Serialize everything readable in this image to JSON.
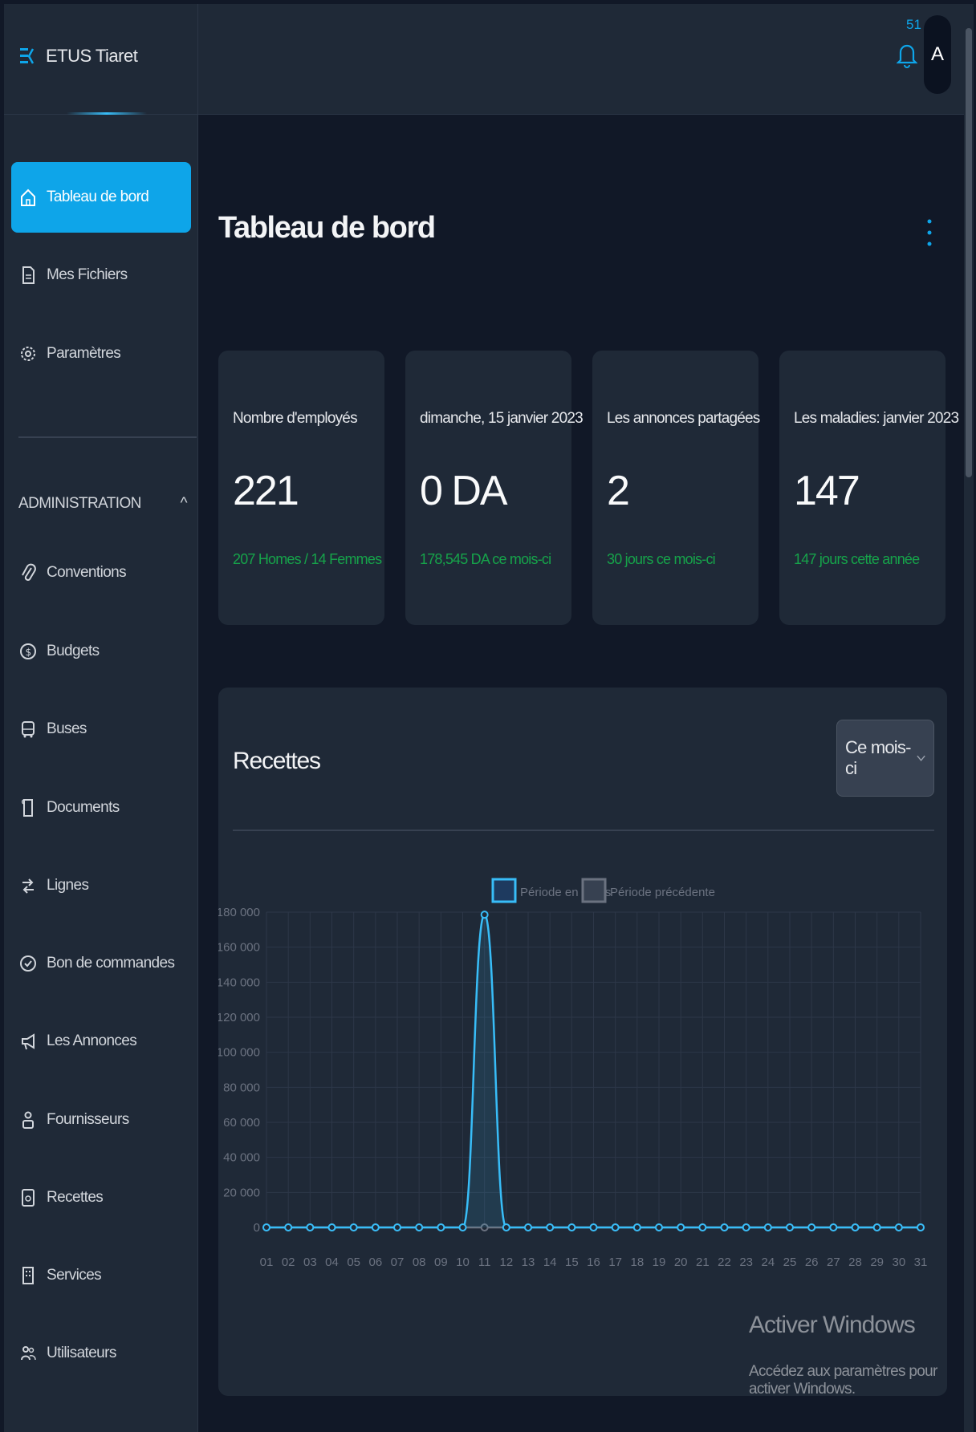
{
  "app": {
    "title": "ETUS Tiaret"
  },
  "header": {
    "notifications_count": "51",
    "avatar_initial": "A"
  },
  "sidebar": {
    "items": [
      {
        "label": "Tableau de bord",
        "icon": "home-icon",
        "active": true
      },
      {
        "label": "Mes Fichiers",
        "icon": "file-icon"
      },
      {
        "label": "Paramètres",
        "icon": "gear-icon"
      }
    ],
    "section": {
      "title": "ADMINISTRATION",
      "toggle": "^"
    },
    "admin_items": [
      {
        "label": "Conventions",
        "icon": "paperclip-icon"
      },
      {
        "label": "Budgets",
        "icon": "dollar-icon"
      },
      {
        "label": "Buses",
        "icon": "bus-icon"
      },
      {
        "label": "Documents",
        "icon": "document-icon"
      },
      {
        "label": "Lignes",
        "icon": "arrows-icon"
      },
      {
        "label": "Bon de commandes",
        "icon": "check-circle-icon"
      },
      {
        "label": "Les Annonces",
        "icon": "megaphone-icon"
      },
      {
        "label": "Fournisseurs",
        "icon": "users-icon"
      },
      {
        "label": "Recettes",
        "icon": "receipt-icon"
      },
      {
        "label": "Services",
        "icon": "building-icon"
      },
      {
        "label": "Utilisateurs",
        "icon": "user-group-icon"
      }
    ]
  },
  "main": {
    "title": "Tableau de bord",
    "cards": [
      {
        "label": "Nombre d'employés",
        "value": "221",
        "sub": "207 Homes / 14 Femmes"
      },
      {
        "label": "dimanche, 15 janvier 2023",
        "value": "0 DA",
        "sub": "178,545 DA ce mois-ci"
      },
      {
        "label": "Les annonces partagées",
        "value": "2",
        "sub": "30 jours ce mois-ci"
      },
      {
        "label": "Les maladies: janvier 2023",
        "value": "147",
        "sub": "147 jours cette année"
      }
    ],
    "panel": {
      "title": "Recettes",
      "select_value": "Ce mois-ci"
    }
  },
  "chart_data": {
    "type": "area",
    "title": "",
    "xlabel": "",
    "ylabel": "",
    "ylim": [
      0,
      180000
    ],
    "yticks": [
      "0",
      "20 000",
      "40 000",
      "60 000",
      "80 000",
      "100 000",
      "120 000",
      "140 000",
      "160 000",
      "180 000"
    ],
    "x": [
      "01",
      "02",
      "03",
      "04",
      "05",
      "06",
      "07",
      "08",
      "09",
      "10",
      "11",
      "12",
      "13",
      "14",
      "15",
      "16",
      "17",
      "18",
      "19",
      "20",
      "21",
      "22",
      "23",
      "24",
      "25",
      "26",
      "27",
      "28",
      "29",
      "30",
      "31"
    ],
    "series": [
      {
        "name": "Période en cours",
        "color": "#38bdf8",
        "values": [
          0,
          0,
          0,
          0,
          0,
          0,
          0,
          0,
          0,
          0,
          178545,
          0,
          0,
          0,
          0,
          0,
          0,
          0,
          0,
          0,
          0,
          0,
          0,
          0,
          0,
          0,
          0,
          0,
          0,
          0,
          0
        ]
      },
      {
        "name": "Période précédente",
        "color": "#6b7280",
        "values": [
          0,
          0,
          0,
          0,
          0,
          0,
          0,
          0,
          0,
          0,
          0,
          0,
          0,
          0,
          0,
          0,
          0,
          0,
          0,
          0,
          0,
          0,
          0,
          0,
          0,
          0,
          0,
          0,
          0,
          0,
          0
        ]
      }
    ],
    "grid": true,
    "legend": "top-center"
  },
  "watermark": {
    "title": "Activer Windows",
    "subtitle": "Accédez aux paramètres pour activer Windows."
  }
}
